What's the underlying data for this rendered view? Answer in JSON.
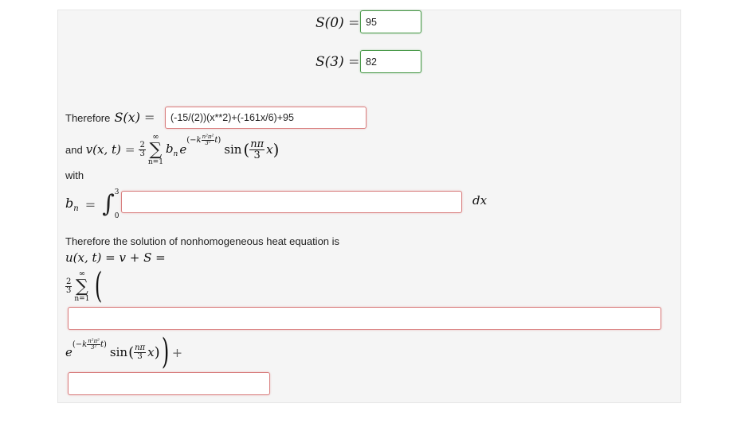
{
  "rows": {
    "s0": {
      "label": "S(0)",
      "eq": "=",
      "value": "95"
    },
    "s3": {
      "label": "S(3)",
      "eq": "=",
      "value": "82"
    }
  },
  "sx": {
    "therefore": "Therefore",
    "label": "S(x)",
    "eq": "=",
    "value": "(-15/(2))(x**2)+(-161x/6)+95"
  },
  "vx": {
    "and": "and",
    "label": "v(x, t)",
    "eq": "=",
    "coef_num": "2",
    "coef_den": "3",
    "sum_top": "∞",
    "sum_bottom": "n=1",
    "bn": "b",
    "bn_sub": "n",
    "e": "e",
    "exponent": "−k",
    "exp_num": "n²π²",
    "exp_den": "3²",
    "exp_t": "t",
    "sin": "sin",
    "arg_num": "nπ",
    "arg_den": "3",
    "arg_x": "x"
  },
  "with_label": "with",
  "bn_row": {
    "label": "b",
    "label_sub": "n",
    "eq": "=",
    "int_top": "3",
    "int_bottom": "0",
    "value": "",
    "dx": "dx"
  },
  "solution": {
    "sentence": "Therefore the solution of nonhomogeneous heat equation is",
    "lhs": "u(x, t) = v + S =",
    "coef_num": "2",
    "coef_den": "3",
    "sum_top": "∞",
    "sum_bottom": "n=1",
    "paren_open": "(",
    "input1_value": "",
    "e": "e",
    "exponent": "−k",
    "exp_num": "n²π²",
    "exp_den": "3²",
    "exp_t": "t",
    "sin": "sin",
    "arg_num": "nπ",
    "arg_den": "3",
    "arg_x": "x",
    "paren_close": ")",
    "plus": "+",
    "input2_value": ""
  },
  "colors": {
    "valid_border": "#4a9a4a",
    "invalid_border": "#d98080",
    "panel_bg": "#f5f5f5"
  }
}
